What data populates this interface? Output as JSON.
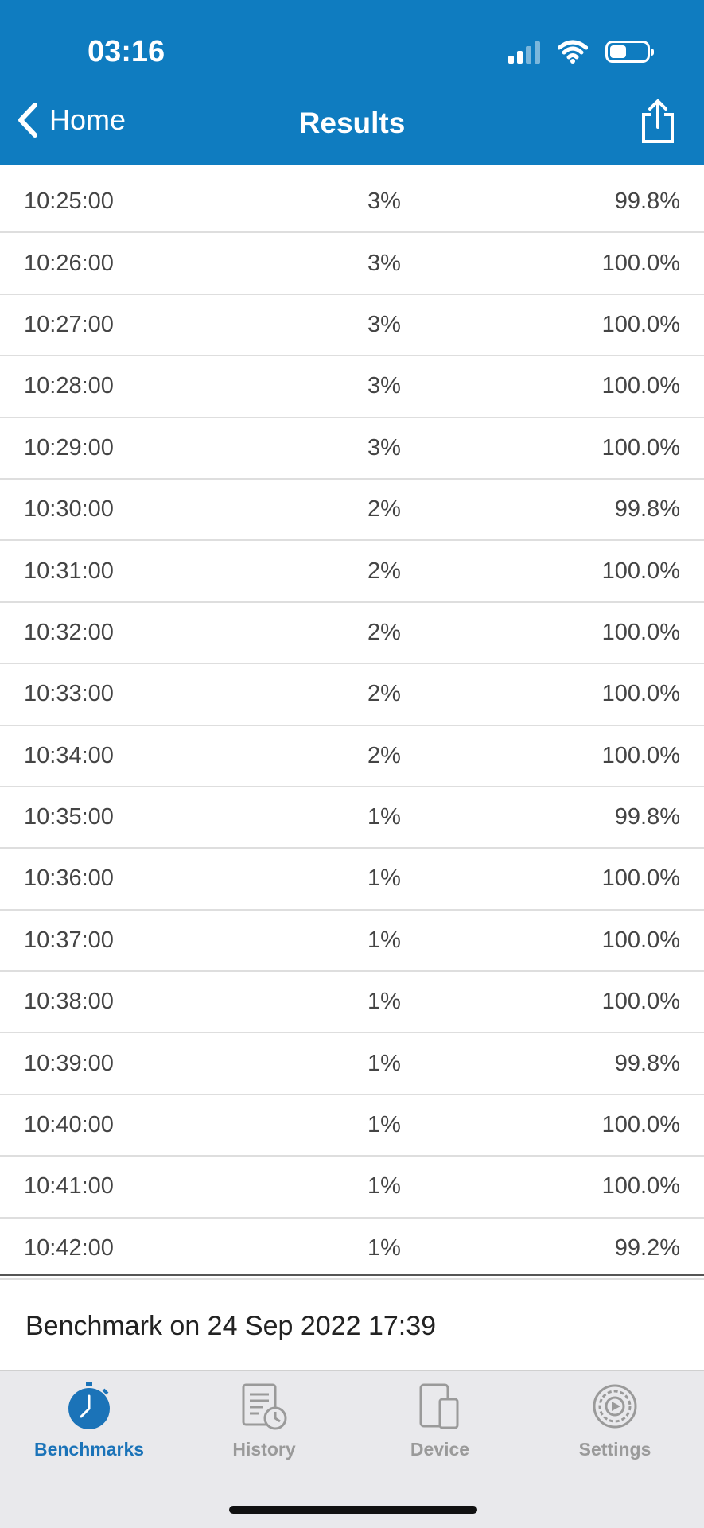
{
  "status_bar": {
    "time": "03:16"
  },
  "nav": {
    "back_label": "Home",
    "title": "Results"
  },
  "rows": [
    {
      "time": "10:25:00",
      "pct": "3%",
      "value": "99.8%"
    },
    {
      "time": "10:26:00",
      "pct": "3%",
      "value": "100.0%"
    },
    {
      "time": "10:27:00",
      "pct": "3%",
      "value": "100.0%"
    },
    {
      "time": "10:28:00",
      "pct": "3%",
      "value": "100.0%"
    },
    {
      "time": "10:29:00",
      "pct": "3%",
      "value": "100.0%"
    },
    {
      "time": "10:30:00",
      "pct": "2%",
      "value": "99.8%"
    },
    {
      "time": "10:31:00",
      "pct": "2%",
      "value": "100.0%"
    },
    {
      "time": "10:32:00",
      "pct": "2%",
      "value": "100.0%"
    },
    {
      "time": "10:33:00",
      "pct": "2%",
      "value": "100.0%"
    },
    {
      "time": "10:34:00",
      "pct": "2%",
      "value": "100.0%"
    },
    {
      "time": "10:35:00",
      "pct": "1%",
      "value": "99.8%"
    },
    {
      "time": "10:36:00",
      "pct": "1%",
      "value": "100.0%"
    },
    {
      "time": "10:37:00",
      "pct": "1%",
      "value": "100.0%"
    },
    {
      "time": "10:38:00",
      "pct": "1%",
      "value": "100.0%"
    },
    {
      "time": "10:39:00",
      "pct": "1%",
      "value": "99.8%"
    },
    {
      "time": "10:40:00",
      "pct": "1%",
      "value": "100.0%"
    },
    {
      "time": "10:41:00",
      "pct": "1%",
      "value": "100.0%"
    },
    {
      "time": "10:42:00",
      "pct": "1%",
      "value": "99.2%"
    }
  ],
  "footer": {
    "benchmark_text": "Benchmark on 24 Sep 2022 17:39"
  },
  "tabbar": {
    "tabs": [
      {
        "label": "Benchmarks",
        "icon": "stopwatch-icon",
        "active": true
      },
      {
        "label": "History",
        "icon": "history-icon",
        "active": false
      },
      {
        "label": "Device",
        "icon": "device-icon",
        "active": false
      },
      {
        "label": "Settings",
        "icon": "gear-icon",
        "active": false
      }
    ]
  },
  "colors": {
    "brand": "#0f7cc0",
    "active_tab": "#1b73b8",
    "inactive_tab": "#9a9a9a"
  }
}
